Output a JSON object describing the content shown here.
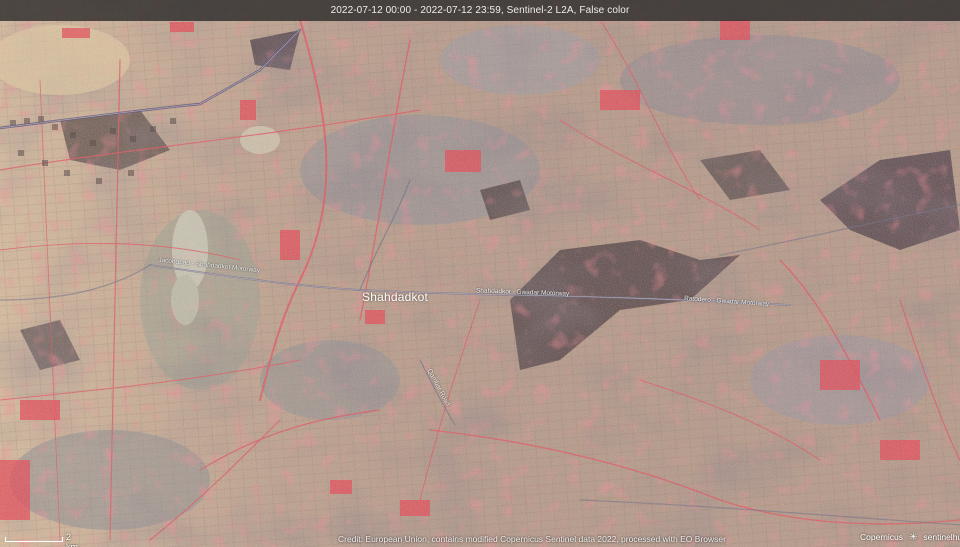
{
  "header": {
    "title": "2022-07-12 00:00 - 2022-07-12 23:59, Sentinel-2 L2A, False color"
  },
  "map": {
    "city_label": "Shahdadkot",
    "road_labels": [
      "Jacobabad - Shahdadkot Motorway",
      "Shahdadkot - Gwadar Motorway",
      "Ratodero - Gwadar Motorway",
      "Qambar Road"
    ]
  },
  "footer": {
    "credit": "Credit: European Union, contains modified Copernicus Sentinel data 2022, processed with EO Browser",
    "scale_label": "2 km",
    "copernicus_label": "Copernicus",
    "sentinel_hub_label": "sentinelhub"
  }
}
